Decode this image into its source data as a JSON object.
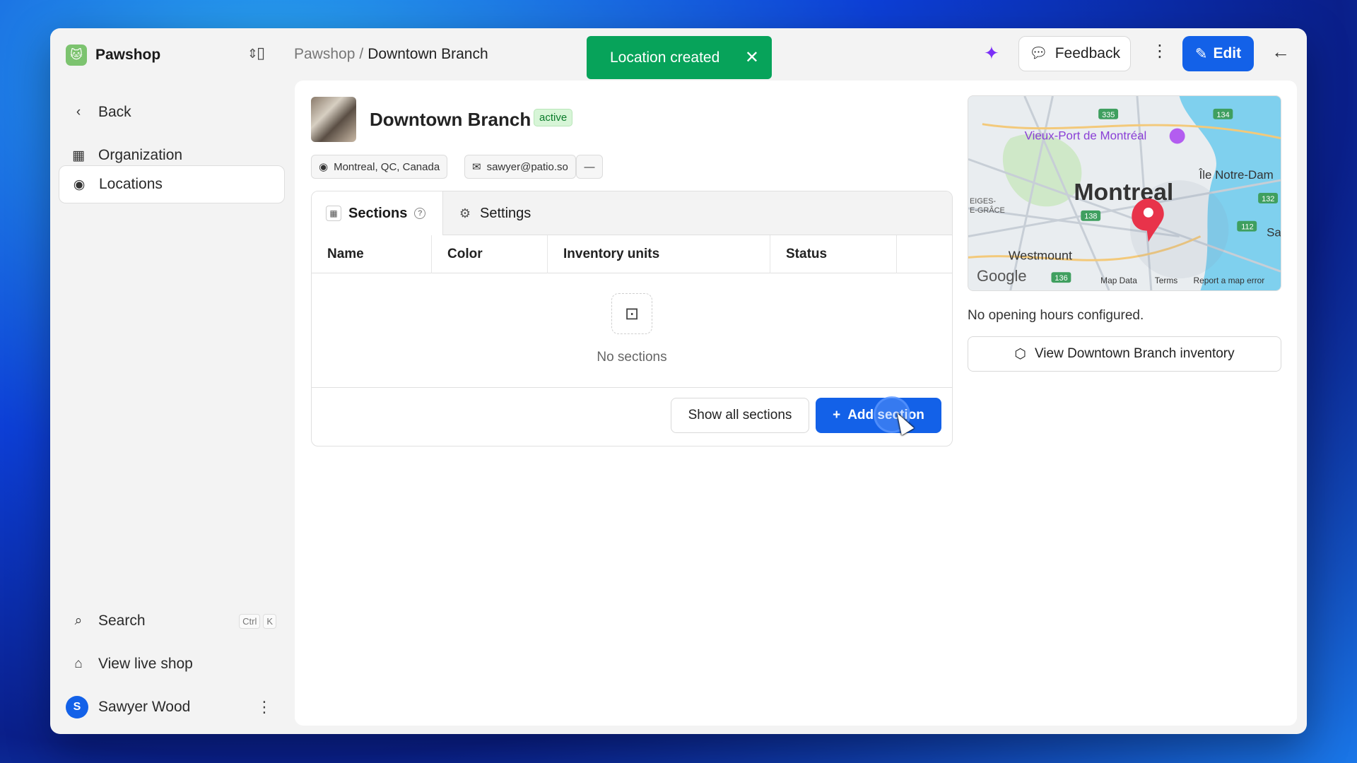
{
  "app": {
    "org_name": "Pawshop"
  },
  "sidebar": {
    "back_label": "Back",
    "items": [
      {
        "label": "Organization",
        "icon": "building-icon"
      },
      {
        "label": "Locations",
        "icon": "map-pin-icon",
        "active": true
      }
    ],
    "search_label": "Search",
    "search_shortcut": [
      "Ctrl",
      "K"
    ],
    "view_live_label": "View live shop",
    "user": {
      "initial": "S",
      "name": "Sawyer Wood"
    }
  },
  "header": {
    "breadcrumb_parent": "Pawshop",
    "breadcrumb_sep": "/",
    "breadcrumb_current": "Downtown Branch",
    "feedback_label": "Feedback",
    "edit_label": "Edit"
  },
  "toast": {
    "message": "Location created"
  },
  "location": {
    "title": "Downtown Branch",
    "status": "active",
    "address": "Montreal, QC, Canada",
    "email": "sawyer@patio.so",
    "extra": "—"
  },
  "tabs": [
    {
      "label": "Sections"
    },
    {
      "label": "Settings"
    }
  ],
  "table": {
    "columns": [
      "Name",
      "Color",
      "Inventory units",
      "Status"
    ],
    "empty_text": "No sections"
  },
  "actions": {
    "show_all": "Show all sections",
    "add_section": "Add section"
  },
  "map": {
    "city": "Montreal",
    "poi": "Vieux-Port de Montréal",
    "island": "Île Notre-Dam",
    "district": "Westmount",
    "district2": "EIGES-\nE-GRÂCE",
    "side": "Sai",
    "brand": "Google",
    "map_data": "Map Data",
    "terms": "Terms",
    "report": "Report a map error",
    "route_labels": [
      "335",
      "134",
      "138",
      "132",
      "112",
      "136"
    ]
  },
  "details": {
    "hours_text": "No opening hours configured.",
    "inventory_btn": "View Downtown Branch inventory"
  },
  "colors": {
    "accent": "#1361e8",
    "toast": "#07a35a",
    "badge_bg": "#d7f5d7",
    "sparkle": "#7b2ff7"
  }
}
